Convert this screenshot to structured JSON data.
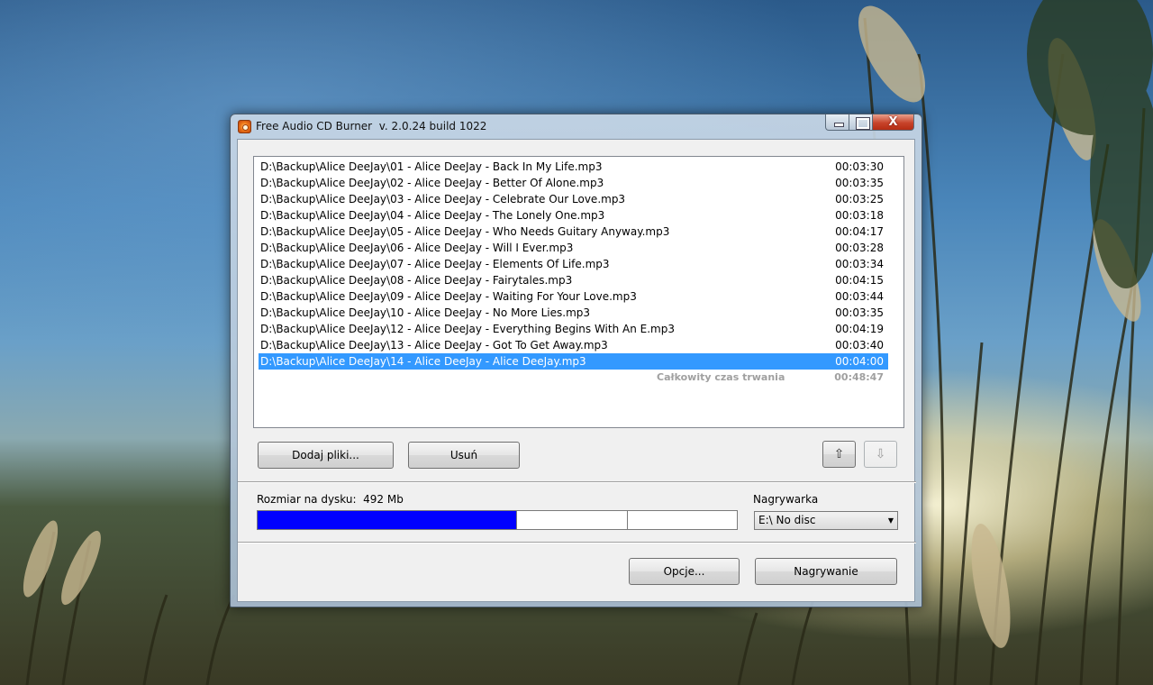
{
  "window": {
    "title": "Free Audio CD Burner  v. 2.0.24 build 1022",
    "close_glyph": "X"
  },
  "tracks": [
    {
      "path": "D:\\Backup\\Alice DeeJay\\01 - Alice DeeJay - Back In My Life.mp3",
      "duration": "00:03:30"
    },
    {
      "path": "D:\\Backup\\Alice DeeJay\\02 - Alice DeeJay - Better Of Alone.mp3",
      "duration": "00:03:35"
    },
    {
      "path": "D:\\Backup\\Alice DeeJay\\03 - Alice DeeJay - Celebrate Our Love.mp3",
      "duration": "00:03:25"
    },
    {
      "path": "D:\\Backup\\Alice DeeJay\\04 - Alice DeeJay - The Lonely One.mp3",
      "duration": "00:03:18"
    },
    {
      "path": "D:\\Backup\\Alice DeeJay\\05 - Alice DeeJay - Who Needs Guitary Anyway.mp3",
      "duration": "00:04:17"
    },
    {
      "path": "D:\\Backup\\Alice DeeJay\\06 - Alice DeeJay - Will I Ever.mp3",
      "duration": "00:03:28"
    },
    {
      "path": "D:\\Backup\\Alice DeeJay\\07 - Alice DeeJay - Elements Of Life.mp3",
      "duration": "00:03:34"
    },
    {
      "path": "D:\\Backup\\Alice DeeJay\\08 - Alice DeeJay - Fairytales.mp3",
      "duration": "00:04:15"
    },
    {
      "path": "D:\\Backup\\Alice DeeJay\\09 - Alice DeeJay - Waiting For Your Love.mp3",
      "duration": "00:03:44"
    },
    {
      "path": "D:\\Backup\\Alice DeeJay\\10 - Alice DeeJay - No More Lies.mp3",
      "duration": "00:03:35"
    },
    {
      "path": "D:\\Backup\\Alice DeeJay\\12 - Alice DeeJay - Everything Begins With An E.mp3",
      "duration": "00:04:19"
    },
    {
      "path": "D:\\Backup\\Alice DeeJay\\13 - Alice DeeJay - Got To Get Away.mp3",
      "duration": "00:03:40"
    },
    {
      "path": "D:\\Backup\\Alice DeeJay\\14 - Alice DeeJay - Alice DeeJay.mp3",
      "duration": "00:04:00",
      "selected": true
    }
  ],
  "total": {
    "label": "Całkowity czas trwania",
    "value": "00:48:47"
  },
  "buttons": {
    "add_files": "Dodaj pliki...",
    "remove": "Usuń",
    "move_up": "⇧",
    "move_down": "⇩",
    "options": "Opcje...",
    "burn": "Nagrywanie"
  },
  "disk": {
    "size_label": "Rozmiar na dysku:  492 Mb",
    "usage_fraction": 0.54,
    "capacity_marks": [
      0.54,
      0.77
    ]
  },
  "burner": {
    "label": "Nagrywarka",
    "selected": "E:\\ No disc"
  },
  "colors": {
    "selection": "#3399ff",
    "progress_fill": "#0000ff"
  }
}
